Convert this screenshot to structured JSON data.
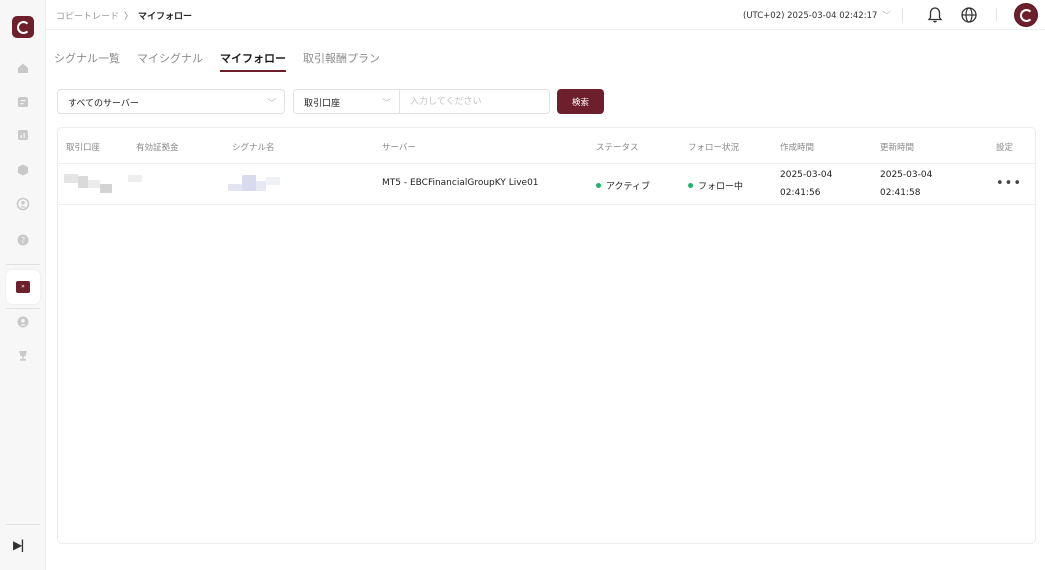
{
  "sidebar": {
    "logo_icon": "ebc-logo-icon",
    "items": [
      {
        "icon": "home-icon"
      },
      {
        "icon": "account-icon"
      },
      {
        "icon": "chart-icon"
      },
      {
        "icon": "cube-icon"
      },
      {
        "icon": "user-icon"
      },
      {
        "icon": "help-icon"
      },
      {
        "icon": "copy-trade-icon",
        "active": true
      },
      {
        "icon": "profile-icon"
      },
      {
        "icon": "trophy-icon"
      }
    ],
    "collapse_icon": "collapse-icon"
  },
  "header": {
    "breadcrumb_parent": "コピートレード",
    "breadcrumb_separator": "〉",
    "breadcrumb_current": "マイフォロー",
    "timezone_label": "(UTC+02) 2025-03-04 02:42:17",
    "timezone_chevron": "﹀"
  },
  "tabs": [
    {
      "label": "シグナル一覧",
      "active": false
    },
    {
      "label": "マイシグナル",
      "active": false
    },
    {
      "label": "マイフォロー",
      "active": true
    },
    {
      "label": "取引報酬プラン",
      "active": false
    }
  ],
  "filters": {
    "server_select": "すべてのサーバー",
    "account_select": "取引口座",
    "search_placeholder": "入力してください",
    "search_button": "検索",
    "chevron": "﹀"
  },
  "table": {
    "columns": [
      "取引口座",
      "有効証拠金",
      "シグナル名",
      "サーバー",
      "ステータス",
      "フォロー状況",
      "作成時間",
      "更新時間",
      "設定"
    ],
    "rows": [
      {
        "server": "MT5 - EBCFinancialGroupKY Live01",
        "status": "アクティブ",
        "follow_status": "フォロー中",
        "created_date": "2025-03-04",
        "created_time": "02:41:56",
        "updated_date": "2025-03-04",
        "updated_time": "02:41:58",
        "settings": "•••"
      }
    ]
  },
  "colors": {
    "brand": "#6e1f2c",
    "active_status": "#1fb36b"
  }
}
